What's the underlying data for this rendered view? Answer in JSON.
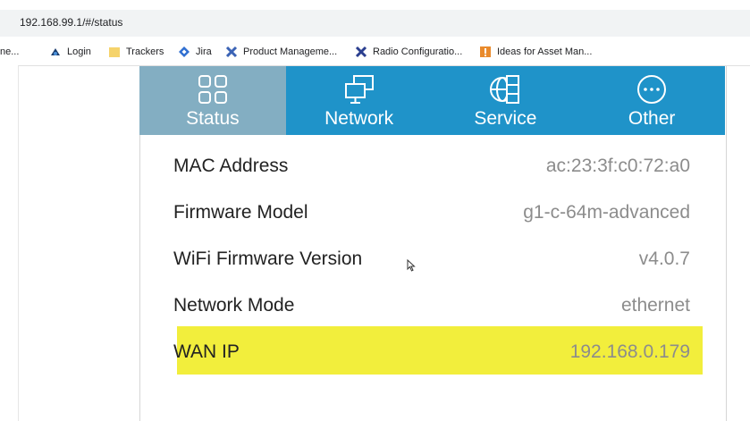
{
  "browser": {
    "url": "192.168.99.1/#/status"
  },
  "bookmarks": [
    {
      "label": "ne...",
      "icon": "page-icon"
    },
    {
      "label": "Login",
      "icon": "cloud-icon"
    },
    {
      "label": "Trackers",
      "icon": "folder-icon"
    },
    {
      "label": "Jira",
      "icon": "jira-icon"
    },
    {
      "label": "Product Manageme...",
      "icon": "x-icon"
    },
    {
      "label": "Radio Configuratio...",
      "icon": "x-icon"
    },
    {
      "label": "Ideas for Asset Man...",
      "icon": "idea-icon"
    }
  ],
  "tabs": [
    {
      "label": "Status",
      "icon": "grid-icon",
      "active": true
    },
    {
      "label": "Network",
      "icon": "monitors-icon",
      "active": false
    },
    {
      "label": "Service",
      "icon": "globe-icon",
      "active": false
    },
    {
      "label": "Other",
      "icon": "ellipsis-icon",
      "active": false
    }
  ],
  "status_rows": [
    {
      "label": "MAC Address",
      "value": "ac:23:3f:c0:72:a0"
    },
    {
      "label": "Firmware Model",
      "value": "g1-c-64m-advanced"
    },
    {
      "label": "WiFi Firmware Version",
      "value": "v4.0.7"
    },
    {
      "label": "Network Mode",
      "value": "ethernet"
    },
    {
      "label": "WAN IP",
      "value": "192.168.0.179"
    }
  ],
  "colors": {
    "tab_bar": "#1f93c9",
    "tab_active": "#83aec2",
    "highlight": "#f2ee3c"
  }
}
